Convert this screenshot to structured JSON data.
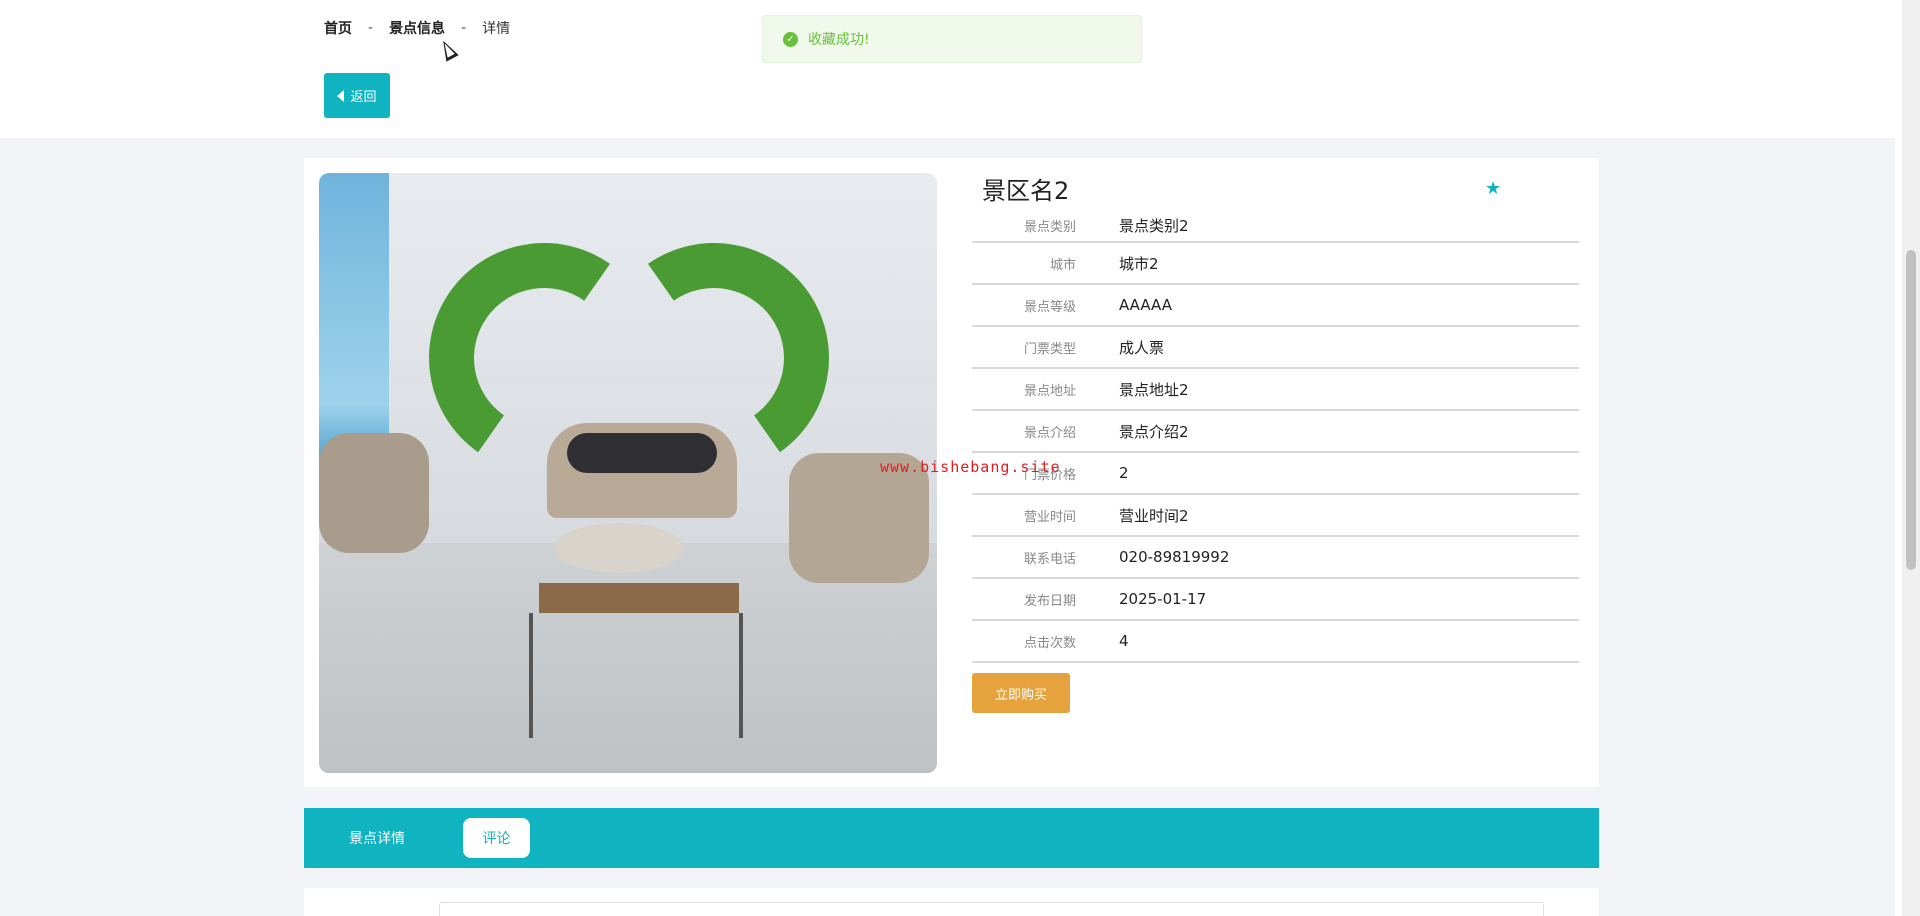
{
  "breadcrumb": {
    "home": "首页",
    "section": "景点信息",
    "current": "详情",
    "separator": "-"
  },
  "back_button": {
    "label": "返回"
  },
  "toast": {
    "message": "收藏成功!",
    "icon": "success-check-icon",
    "color": "#67c23a"
  },
  "watermark": "www.bishebang.site",
  "spot": {
    "title": "景区名2",
    "favorite_icon": "star-icon",
    "fields": [
      {
        "label": "景点类别",
        "value": "景点类别2"
      },
      {
        "label": "城市",
        "value": "城市2"
      },
      {
        "label": "景点等级",
        "value": "AAAAA"
      },
      {
        "label": "门票类型",
        "value": "成人票"
      },
      {
        "label": "景点地址",
        "value": "景点地址2"
      },
      {
        "label": "景点介绍",
        "value": "景点介绍2"
      },
      {
        "label": "门票价格",
        "value": "2"
      },
      {
        "label": "营业时间",
        "value": "营业时间2"
      },
      {
        "label": "联系电话",
        "value": "020-89819992"
      },
      {
        "label": "发布日期",
        "value": "2025-01-17"
      },
      {
        "label": "点击次数",
        "value": "4"
      }
    ],
    "buy_button": "立即购买"
  },
  "tabs": [
    {
      "label": "景点详情",
      "active": false
    },
    {
      "label": "评论",
      "active": true
    }
  ],
  "colors": {
    "accent": "#10b4c1",
    "buy": "#e6a23c"
  }
}
